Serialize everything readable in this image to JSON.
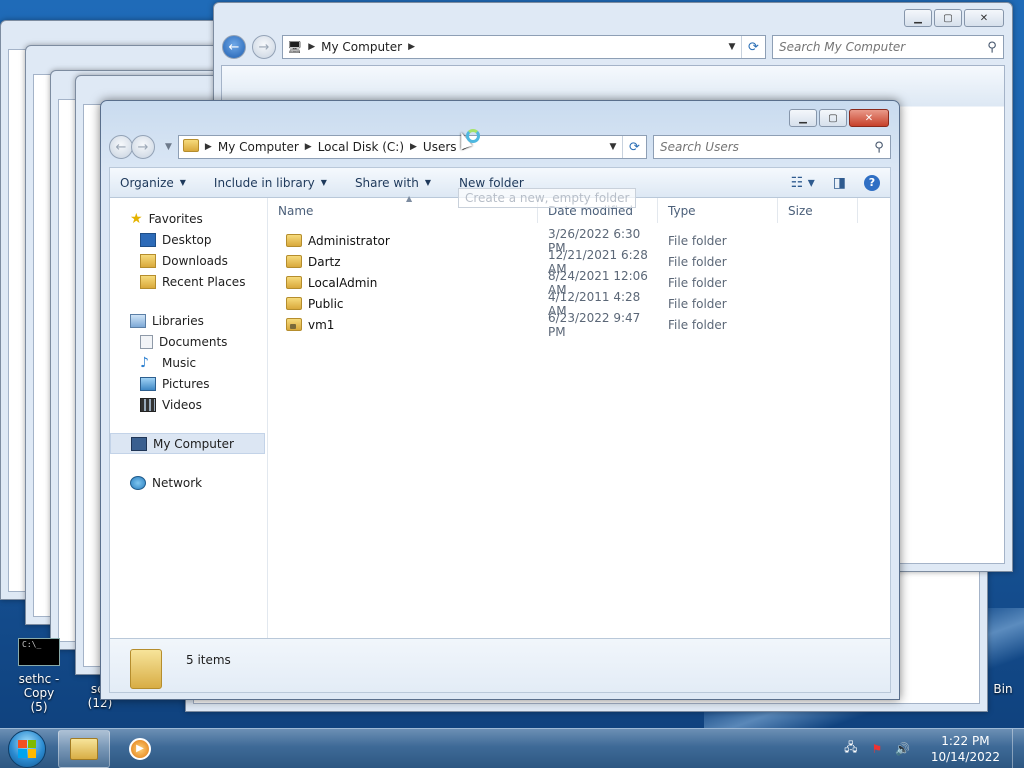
{
  "background_windows": {
    "top_window": {
      "address": "My Computer",
      "search_placeholder": "Search My Computer"
    }
  },
  "window": {
    "address": {
      "crumbs": [
        "My Computer",
        "Local Disk (C:)",
        "Users"
      ]
    },
    "search_placeholder": "Search Users",
    "toolbar": {
      "organize": "Organize",
      "include_in_library": "Include in library",
      "share_with": "Share with",
      "new_folder": "New folder",
      "tooltip": "Create a new, empty folder"
    },
    "nav_pane": {
      "favorites": {
        "label": "Favorites",
        "items": [
          "Desktop",
          "Downloads",
          "Recent Places"
        ]
      },
      "libraries": {
        "label": "Libraries",
        "items": [
          "Documents",
          "Music",
          "Pictures",
          "Videos"
        ]
      },
      "computer": "My Computer",
      "network": "Network"
    },
    "columns": [
      "Name",
      "Date modified",
      "Type",
      "Size"
    ],
    "files": [
      {
        "name": "Administrator",
        "date": "3/26/2022 6:30 PM",
        "type": "File folder",
        "locked": false
      },
      {
        "name": "Dartz",
        "date": "12/21/2021 6:28 AM",
        "type": "File folder",
        "locked": false
      },
      {
        "name": "LocalAdmin",
        "date": "8/24/2021 12:06 AM",
        "type": "File folder",
        "locked": false
      },
      {
        "name": "Public",
        "date": "4/12/2011 4:28 AM",
        "type": "File folder",
        "locked": false
      },
      {
        "name": "vm1",
        "date": "6/23/2022 9:47 PM",
        "type": "File folder",
        "locked": true
      }
    ],
    "status": "5 items"
  },
  "desktop_icons": [
    {
      "label": "sethc - Copy",
      "sublabel": "(5)"
    },
    {
      "label": "set",
      "sublabel": "(12)"
    },
    {
      "label": "Bin",
      "sublabel": ""
    }
  ],
  "taskbar": {
    "time": "1:22 PM",
    "date": "10/14/2022"
  }
}
